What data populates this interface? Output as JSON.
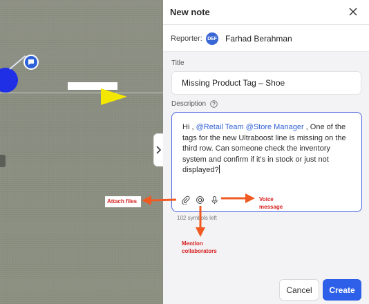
{
  "header": {
    "title": "New note"
  },
  "reporter": {
    "label": "Reporter:",
    "initials": "DEF",
    "name": "Farhad Berahman"
  },
  "title_field": {
    "label": "Title",
    "value": "Missing Product Tag – Shoe"
  },
  "description": {
    "label": "Description",
    "greeting": "Hi , ",
    "mention1": "@Retail Team",
    "space": " ",
    "mention2": "@Store Manager",
    "body": " , One of the tags for the new Ultraboost line is missing on the third row. Can someone check the inventory system and confirm if it's in stock or just not displayed?",
    "counter": "102 symbols left"
  },
  "buttons": {
    "cancel": "Cancel",
    "create": "Create"
  },
  "annotations": {
    "attach": "Attach files",
    "voice_line1": "Voice",
    "voice_line2": "message",
    "mention_line1": "Mention",
    "mention_line2": "collaborators"
  },
  "colors": {
    "accent": "#2d5fe8",
    "annotation": "#d72020",
    "arrow": "#f05a22"
  }
}
